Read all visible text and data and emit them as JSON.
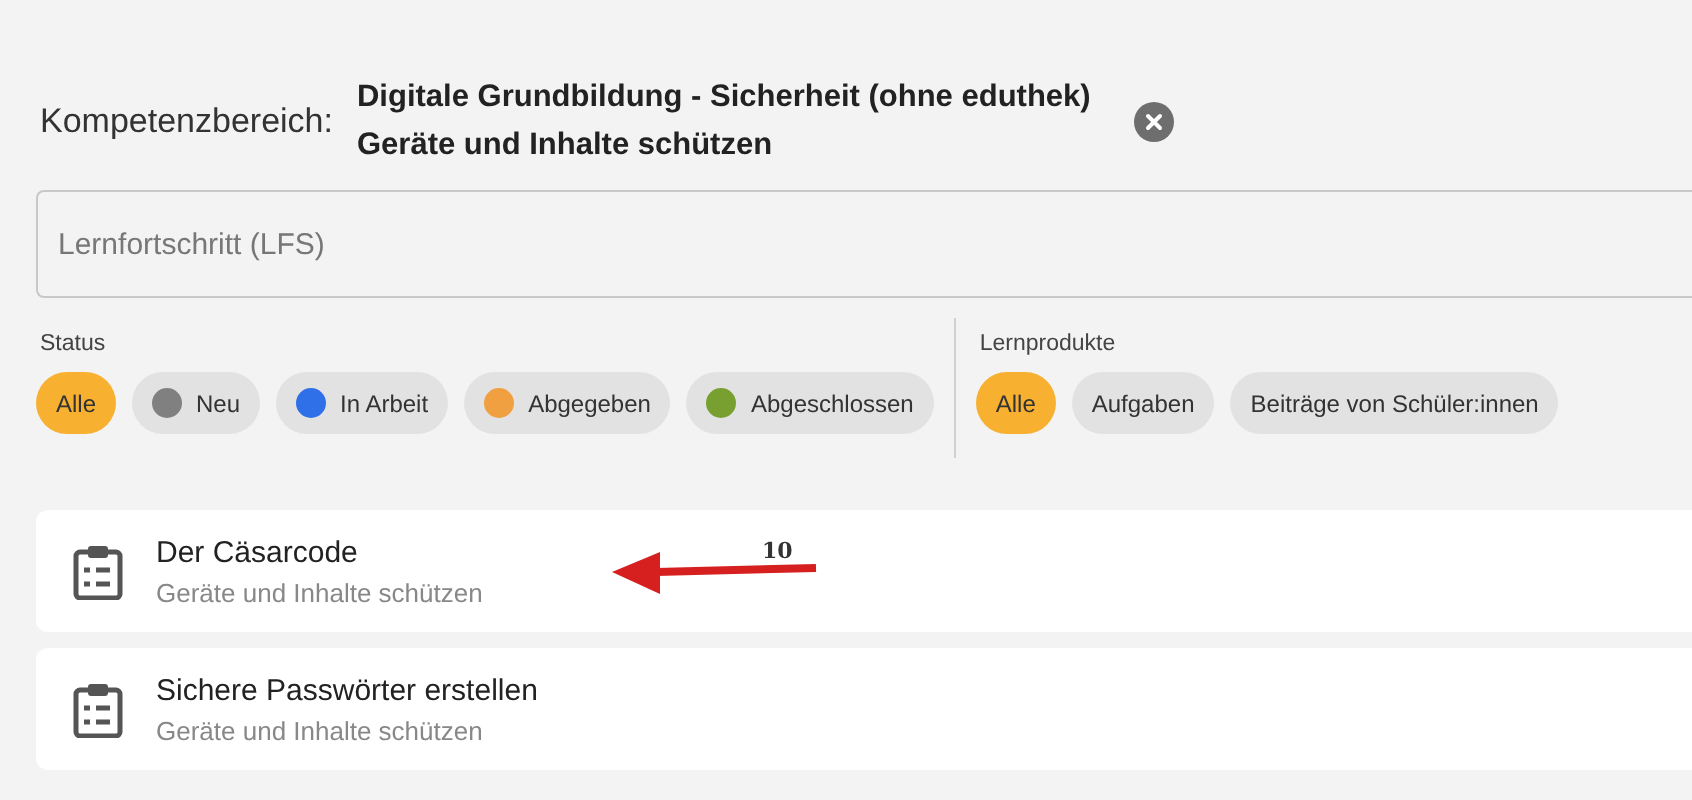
{
  "competence": {
    "label": "Kompetenzbereich:",
    "lines": [
      "Digitale Grundbildung - Sicherheit (ohne eduthek)",
      "Geräte und Inhalte schützen"
    ]
  },
  "search": {
    "placeholder": "Lernfortschritt (LFS)"
  },
  "filter_groups": [
    {
      "label": "Status",
      "chips": [
        {
          "label": "Alle",
          "selected": true
        },
        {
          "label": "Neu",
          "selected": false,
          "color": "#808080"
        },
        {
          "label": "In Arbeit",
          "selected": false,
          "color": "#2f6fe8"
        },
        {
          "label": "Abgegeben",
          "selected": false,
          "color": "#f0a040"
        },
        {
          "label": "Abgeschlossen",
          "selected": false,
          "color": "#78a030"
        }
      ]
    },
    {
      "label": "Lernprodukte",
      "chips": [
        {
          "label": "Alle",
          "selected": true
        },
        {
          "label": "Aufgaben",
          "selected": false
        },
        {
          "label": "Beiträge von Schüler:innen",
          "selected": false
        }
      ]
    }
  ],
  "items": [
    {
      "title": "Der Cäsarcode",
      "subtitle": "Geräte und Inhalte schützen",
      "annotation": "10"
    },
    {
      "title": "Sichere Passwörter erstellen",
      "subtitle": "Geräte und Inhalte schützen"
    }
  ]
}
